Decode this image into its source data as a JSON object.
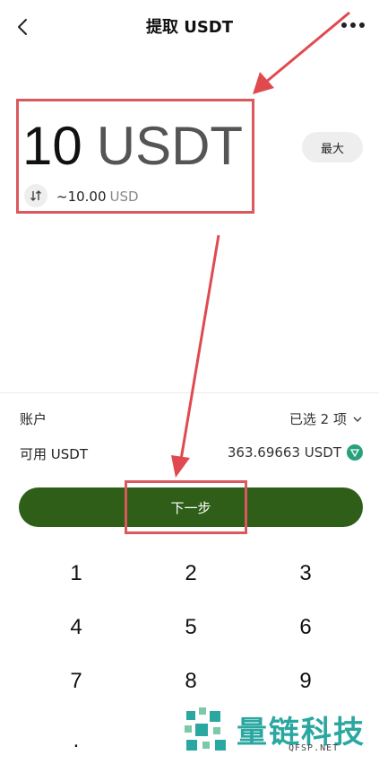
{
  "header": {
    "title": "提取 USDT",
    "back_icon": "chevron-left-icon",
    "more_icon": "more-horizontal-icon"
  },
  "amount": {
    "value": "10",
    "unit": "USDT",
    "fiat_value": "~10.00",
    "fiat_unit": "USD",
    "swap_icon": "swap-vertical-icon"
  },
  "max_button": {
    "label": "最大"
  },
  "account_row": {
    "label": "账户",
    "value": "已选 2 项"
  },
  "available_row": {
    "label": "可用 USDT",
    "value": "363.69663 USDT",
    "icon": "tron-token-icon"
  },
  "next_button": {
    "label": "下一步"
  },
  "keypad": {
    "keys": [
      "1",
      "2",
      "3",
      "4",
      "5",
      "6",
      "7",
      "8",
      "9",
      "."
    ]
  },
  "watermark": {
    "title": "量链科技",
    "subtitle": "QFSP.NET"
  },
  "colors": {
    "primary_button": "#2e5e17",
    "highlight": "#d9595d",
    "brand_watermark": "#2aa7a0",
    "text_primary": "#111111"
  }
}
